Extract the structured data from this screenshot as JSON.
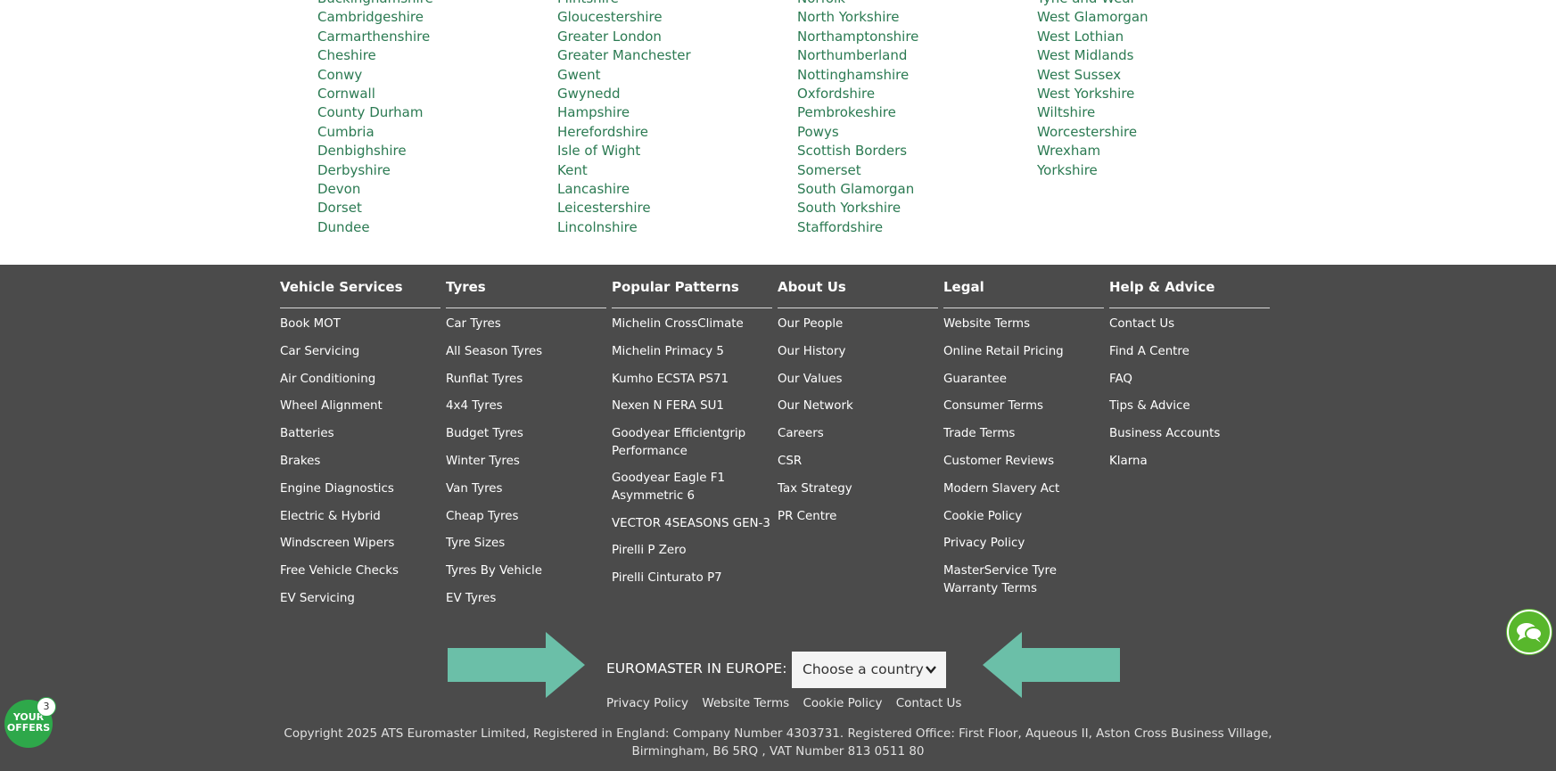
{
  "counties": {
    "col1": [
      "Buckinghamshire",
      "Cambridgeshire",
      "Carmarthenshire",
      "Cheshire",
      "Conwy",
      "Cornwall",
      "County Durham",
      "Cumbria",
      "Denbighshire",
      "Derbyshire",
      "Devon",
      "Dorset",
      "Dundee"
    ],
    "col2": [
      "Flintshire",
      "Gloucestershire",
      "Greater London",
      "Greater Manchester",
      "Gwent",
      "Gwynedd",
      "Hampshire",
      "Herefordshire",
      "Isle of Wight",
      "Kent",
      "Lancashire",
      "Leicestershire",
      "Lincolnshire"
    ],
    "col3": [
      "Norfolk",
      "North Yorkshire",
      "Northamptonshire",
      "Northumberland",
      "Nottinghamshire",
      "Oxfordshire",
      "Pembrokeshire",
      "Powys",
      "Scottish Borders",
      "Somerset",
      "South Glamorgan",
      "South Yorkshire",
      "Staffordshire"
    ],
    "col4": [
      "Tyne and Wear",
      "West Glamorgan",
      "West Lothian",
      "West Midlands",
      "West Sussex",
      "West Yorkshire",
      "Wiltshire",
      "Worcestershire",
      "Wrexham",
      "Yorkshire"
    ]
  },
  "footer": {
    "vehicle_services": {
      "title": "Vehicle Services",
      "items": [
        "Book MOT",
        "Car Servicing",
        "Air Conditioning",
        "Wheel Alignment",
        "Batteries",
        "Brakes",
        "Engine Diagnostics",
        "Electric & Hybrid",
        "Windscreen Wipers",
        "Free Vehicle Checks",
        "EV Servicing"
      ]
    },
    "tyres": {
      "title": "Tyres",
      "items": [
        "Car Tyres",
        "All Season Tyres",
        "Runflat Tyres",
        "4x4 Tyres",
        "Budget Tyres",
        "Winter Tyres",
        "Van Tyres",
        "Cheap Tyres",
        "Tyre Sizes",
        "Tyres By Vehicle",
        "EV Tyres"
      ]
    },
    "popular_patterns": {
      "title": "Popular Patterns",
      "items": [
        "Michelin CrossClimate",
        "Michelin Primacy 5",
        "Kumho ECSTA PS71",
        "Nexen N FERA SU1",
        "Goodyear Efficientgrip Performance",
        "Goodyear Eagle F1 Asymmetric 6",
        "VECTOR 4SEASONS GEN-3",
        "Pirelli P Zero",
        "Pirelli Cinturato P7"
      ]
    },
    "about_us": {
      "title": "About Us",
      "items": [
        "Our People",
        "Our History",
        "Our Values",
        "Our Network",
        "Careers",
        "CSR",
        "Tax Strategy",
        "PR Centre"
      ]
    },
    "legal": {
      "title": "Legal",
      "items": [
        "Website Terms",
        "Online Retail Pricing",
        "Guarantee",
        "Consumer Terms",
        "Trade Terms",
        "Customer Reviews",
        "Modern Slavery Act",
        "Cookie Policy",
        "Privacy Policy",
        "MasterService Tyre Warranty Terms"
      ]
    },
    "help": {
      "title": "Help & Advice",
      "items": [
        "Contact Us",
        "Find A Centre",
        "FAQ",
        "Tips & Advice",
        "Business Accounts",
        "Klarna"
      ]
    }
  },
  "europe": {
    "label": "EUROMASTER IN EUROPE:",
    "select_value": "Choose a country"
  },
  "bottom_links": [
    "Privacy Policy",
    "Website Terms",
    "Cookie Policy",
    "Contact Us"
  ],
  "copyright": {
    "line1": "Copyright 2025 ATS Euromaster Limited, Registered in England: Company Number 4303731. Registered Office: First Floor, Aqueous II, Aston Cross Business Village,",
    "line2": "Birmingham, B6 5RQ , VAT Number 813 0511 80"
  },
  "offers": {
    "label_line1": "YOUR",
    "label_line2": "OFFERS",
    "count": "3"
  },
  "colors": {
    "county_link": "#2b7a52",
    "footer_bg": "#4b4b4b",
    "arrow": "#6bbfa8",
    "chat_green": "#58b72c",
    "offers_green": "#2ea84a"
  },
  "icons": {
    "chat": "chat-bubbles-icon",
    "select": "chevron-down-icon",
    "arrow_left": "arrow-right-icon",
    "arrow_right": "arrow-left-icon"
  }
}
